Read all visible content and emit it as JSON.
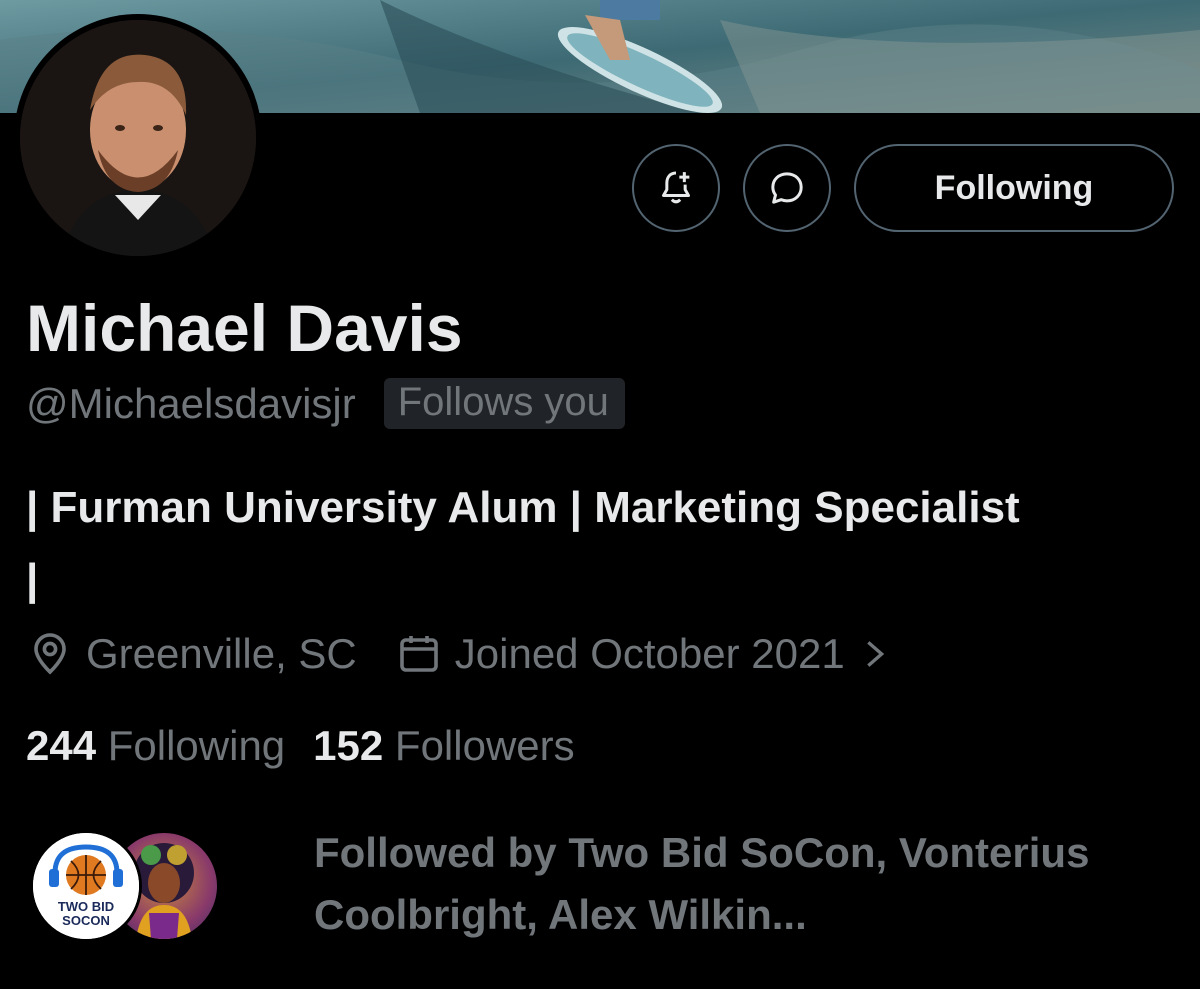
{
  "profile": {
    "name": "Michael Davis",
    "handle": "@Michaelsdavisjr",
    "follows_you_badge": "Follows you",
    "bio": "| Furman University Alum | Marketing Specialist |",
    "location": "Greenville, SC",
    "joined": "Joined October 2021"
  },
  "actions": {
    "follow_label": "Following"
  },
  "stats": {
    "following_count": "244",
    "following_label": "Following",
    "followers_count": "152",
    "followers_label": "Followers"
  },
  "followed_by": {
    "text": "Followed by Two Bid SoCon, Vonterius Coolbright, Alex Wilkin...",
    "avatar_1_text": "TWO BID SOCON"
  },
  "colors": {
    "background": "#000000",
    "primary_text": "#e7e9ea",
    "secondary_text": "#71767b",
    "border": "#536471",
    "badge_bg": "#202327"
  }
}
